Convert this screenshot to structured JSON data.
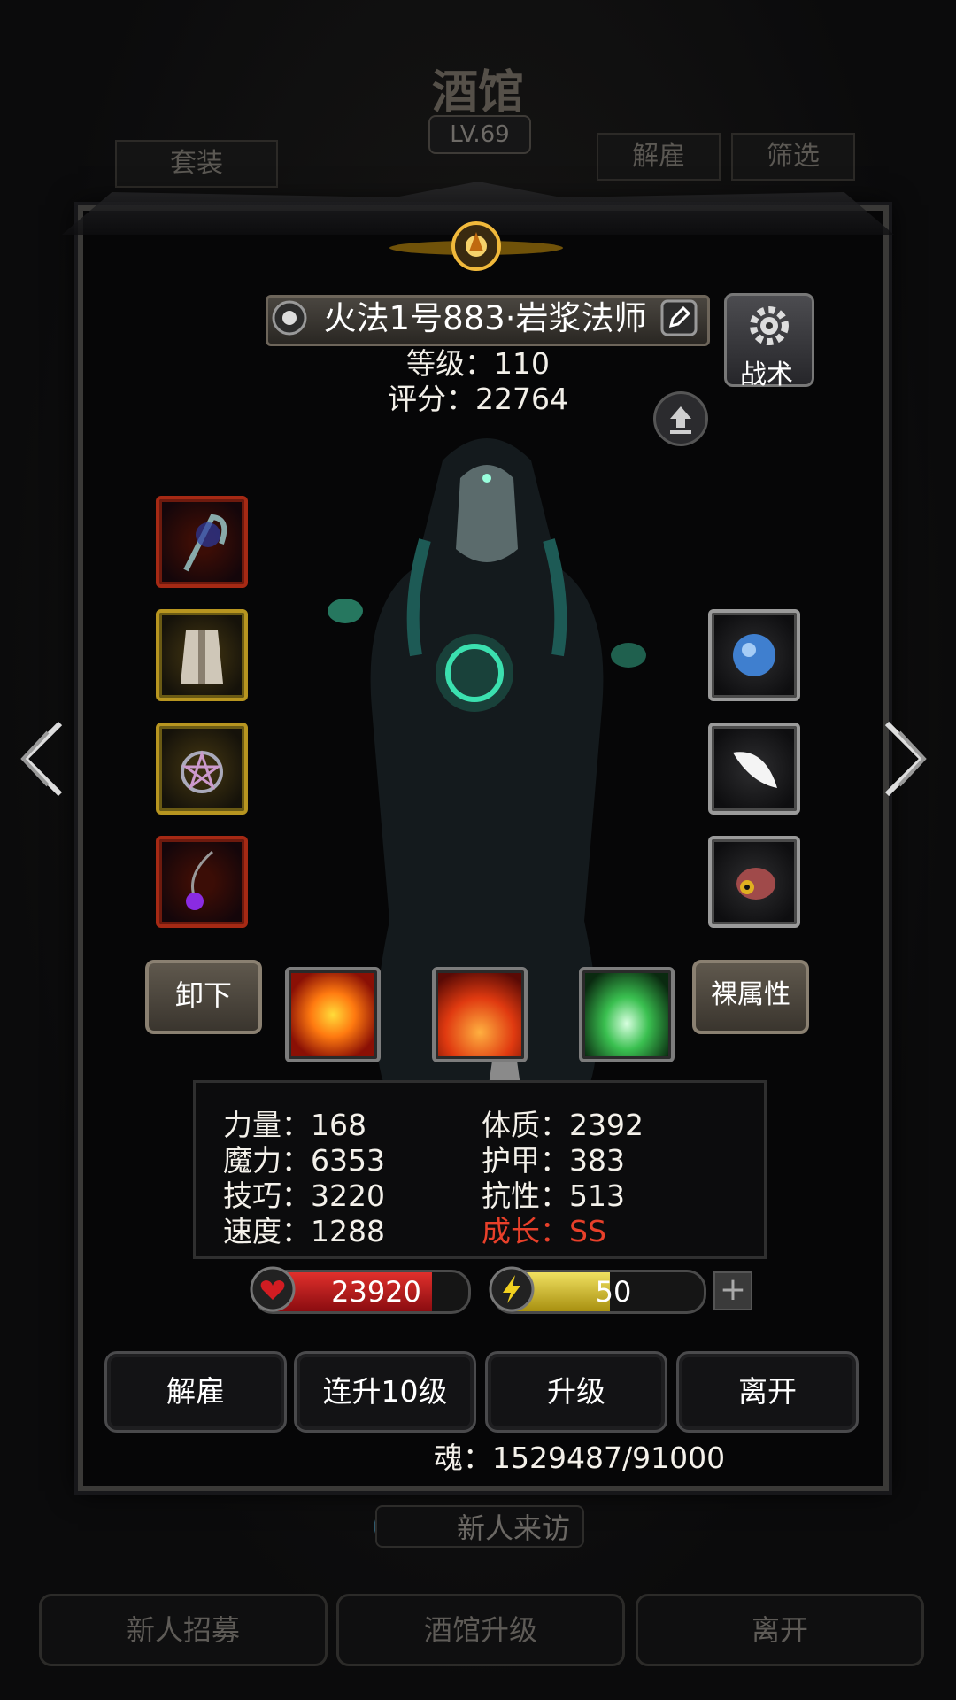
{
  "background": {
    "title": "酒馆",
    "level": "LV.69",
    "btn_suit": "套装",
    "btn_fire": "解雇",
    "btn_filter": "筛选",
    "visit_label": "新人来访",
    "footer": [
      "新人招募",
      "酒馆升级",
      "离开"
    ]
  },
  "hero": {
    "name": "火法1号883·岩浆法师",
    "level_line": "等级：110",
    "score_line": "评分：22764",
    "tactics_label": "战术"
  },
  "skills": {
    "unequip_label": "卸下",
    "bare_attr_label": "裸属性"
  },
  "stats": {
    "left": [
      "力量：168",
      "魔力：6353",
      "技巧：3220",
      "速度：1288"
    ],
    "right": [
      "体质：2392",
      "护甲：383",
      "抗性：513"
    ],
    "growth": "成长：SS"
  },
  "bars": {
    "hp": "23920",
    "hp_fill": 0.83,
    "energy": "50",
    "energy_fill": 0.55
  },
  "actions": {
    "fire": "解雇",
    "levelup10": "连升10级",
    "levelup": "升级",
    "leave": "离开"
  },
  "soul_line": "魂：1529487/91000",
  "colors": {
    "hp_red": "#c8181c",
    "energy_yellow": "#d9c83a",
    "growth_red": "#e8402a"
  }
}
